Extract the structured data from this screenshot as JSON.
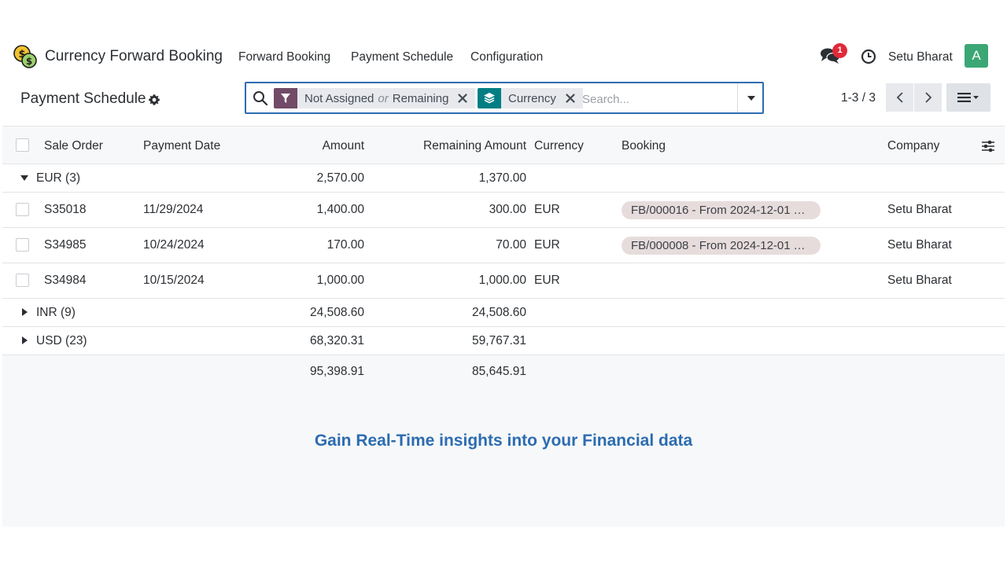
{
  "navbar": {
    "app_name": "Currency Forward Booking",
    "menu": [
      "Forward Booking",
      "Payment Schedule",
      "Configuration"
    ],
    "notification_count": "1",
    "user_name": "Setu Bharat",
    "avatar_letter": "A"
  },
  "control_panel": {
    "title": "Payment Schedule",
    "facets": {
      "filter": {
        "part1": "Not Assigned",
        "or": "or",
        "part2": "Remaining"
      },
      "groupby": {
        "label": "Currency"
      }
    },
    "search_placeholder": "Search...",
    "pager": "1-3 / 3"
  },
  "table": {
    "columns": {
      "sale_order": "Sale Order",
      "payment_date": "Payment Date",
      "amount": "Amount",
      "remaining": "Remaining Amount",
      "currency": "Currency",
      "booking": "Booking",
      "company": "Company"
    },
    "groups": [
      {
        "label": "EUR (3)",
        "amount": "2,570.00",
        "remaining": "1,370.00",
        "expanded": true
      },
      {
        "label": "INR (9)",
        "amount": "24,508.60",
        "remaining": "24,508.60",
        "expanded": false
      },
      {
        "label": "USD (23)",
        "amount": "68,320.31",
        "remaining": "59,767.31",
        "expanded": false
      }
    ],
    "rows": [
      {
        "sale_order": "S35018",
        "payment_date": "11/29/2024",
        "amount": "1,400.00",
        "remaining": "300.00",
        "currency": "EUR",
        "booking": "FB/000016 - From 2024-12-01 To...",
        "company": "Setu Bharat"
      },
      {
        "sale_order": "S34985",
        "payment_date": "10/24/2024",
        "amount": "170.00",
        "remaining": "70.00",
        "currency": "EUR",
        "booking": "FB/000008 - From 2024-12-01 To...",
        "company": "Setu Bharat"
      },
      {
        "sale_order": "S34984",
        "payment_date": "10/15/2024",
        "amount": "1,000.00",
        "remaining": "1,000.00",
        "currency": "EUR",
        "booking": "",
        "company": "Setu Bharat"
      }
    ],
    "totals": {
      "amount": "95,398.91",
      "remaining": "85,645.91"
    }
  },
  "tagline": "Gain Real-Time insights into your Financial data",
  "colors": {
    "accent": "#2d6cb0",
    "filter_facet": "#714b67",
    "groupby_facet": "#017e84",
    "avatar": "#3aa775",
    "badge": "#e02a3a",
    "tagline": "#2c6cb0"
  }
}
